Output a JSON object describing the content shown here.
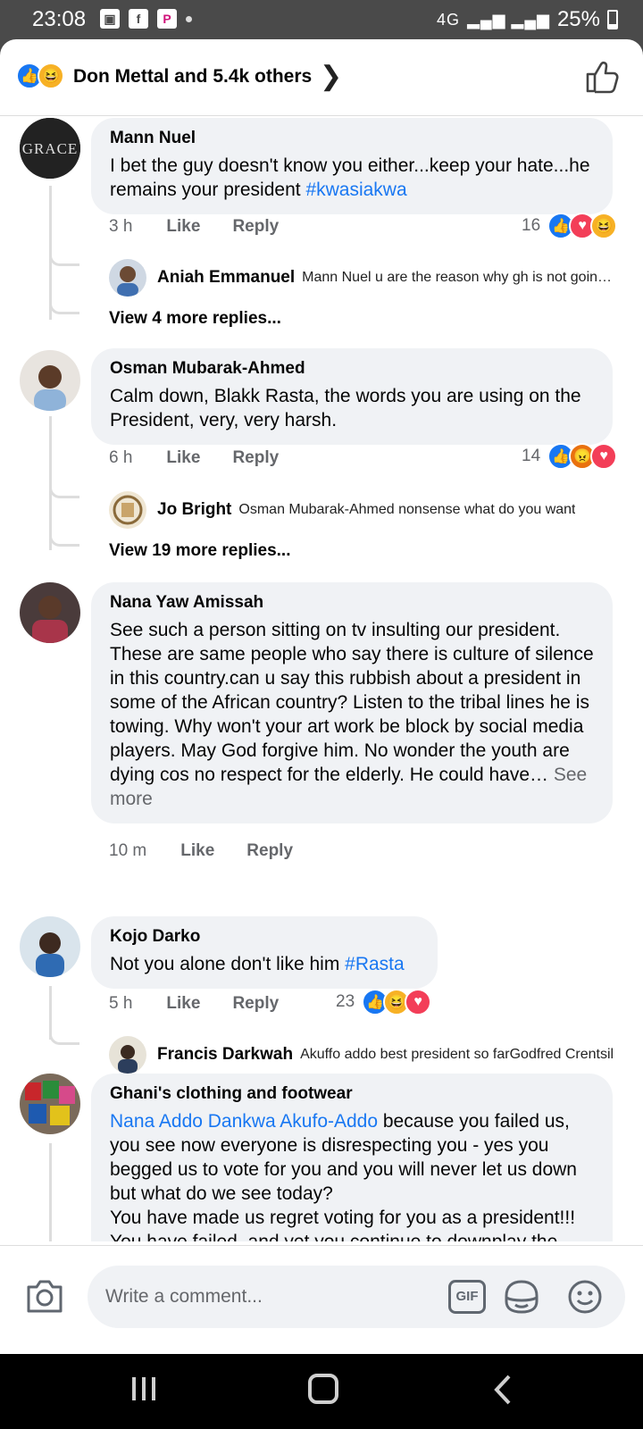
{
  "status_bar": {
    "time": "23:08",
    "network": "4G",
    "battery": "25%",
    "notification_icons": [
      "gallery-icon",
      "facebook-icon",
      "p-app-icon"
    ]
  },
  "header": {
    "reactions_summary": "Don Mettal and 5.4k others",
    "reaction_icons": [
      "like",
      "haha"
    ]
  },
  "comments": [
    {
      "author": "Mann Nuel",
      "text": "I bet the guy doesn't know you either...keep your hate...he remains your president ",
      "tag": "#kwasiakwa",
      "time": "3 h",
      "like_label": "Like",
      "reply_label": "Reply",
      "reaction_count": "16",
      "reaction_icons": [
        "like",
        "love",
        "haha"
      ],
      "reply": {
        "author": "Aniah Emmanuel",
        "text": "Mann Nuel u are the reason why gh is not going anywhere"
      },
      "more_replies": "View 4 more replies..."
    },
    {
      "author": "Osman Mubarak-Ahmed",
      "text": "Calm down, Blakk Rasta, the words you are using on the President, very, very harsh.",
      "time": "6 h",
      "like_label": "Like",
      "reply_label": "Reply",
      "reaction_count": "14",
      "reaction_icons": [
        "like",
        "angry",
        "love"
      ],
      "reply": {
        "author": "Jo Bright",
        "text": "Osman Mubarak-Ahmed  nonsense what do you want"
      },
      "more_replies": "View 19 more replies..."
    },
    {
      "author": "Nana Yaw Amissah",
      "text": "See such a person sitting on tv insulting our president. These are same people who say there is culture of silence in this country.can u say this rubbish about a president in some of the African country? Listen to the tribal lines he is towing. Why won't your art work be block by social media players. May God forgive him. No wonder the youth are dying cos no respect for the elderly. He could have… ",
      "see_more": "See more",
      "time": "10 m",
      "like_label": "Like",
      "reply_label": "Reply"
    },
    {
      "author": "Kojo Darko",
      "text": "Not you alone don't like him ",
      "tag": "#Rasta",
      "time": "5 h",
      "like_label": "Like",
      "reply_label": "Reply",
      "reaction_count": "23",
      "reaction_icons": [
        "like",
        "haha",
        "love"
      ],
      "reply": {
        "author": "Francis Darkwah",
        "text": "Akuffo addo best president so farGodfred Crentsil"
      }
    },
    {
      "author": "Ghani's clothing and footwear",
      "tag_lead": "Nana Addo Dankwa Akufo-Addo",
      "text": " because you failed us, you see now everyone is disrespecting you - yes you begged us to vote for you and you will never let us down but what do we see today?\nYou have made us regret voting for you as a president!!!\nYou have failed, and yet you continue to downplay the legacies of those who made way for freedom and even became a president"
    }
  ],
  "compose": {
    "placeholder": "Write a comment...",
    "gif_label": "GIF"
  },
  "colors": {
    "accent": "#1877f2",
    "bubble": "#f0f2f5",
    "secondary_text": "#65676b"
  }
}
